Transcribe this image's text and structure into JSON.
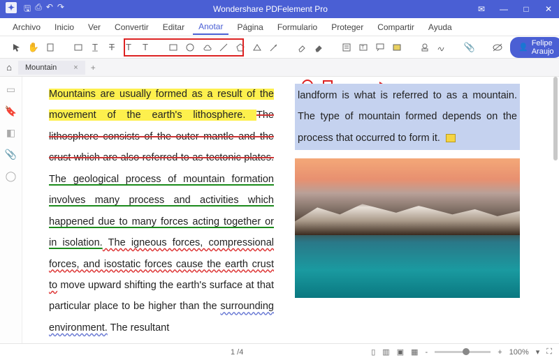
{
  "titlebar": {
    "app": "Wondershare PDFelement Pro"
  },
  "menu": {
    "items": [
      "Archivo",
      "Inicio",
      "Ver",
      "Convertir",
      "Editar",
      "Anotar",
      "Página",
      "Formulario",
      "Proteger",
      "Compartir",
      "Ayuda"
    ],
    "activeIndex": 5
  },
  "user": {
    "name": "Felipe Araujo"
  },
  "tab": {
    "name": "Mountain"
  },
  "document": {
    "col1": {
      "s1": "Mountains are usually formed as a result of the movement of the earth's lithosphere. ",
      "s2": "The lithosphere consists of the outer mantle and the crust which are also referred to as tectonic plates.",
      "s3": " The geological process of mountain formation involves many process and activities which happened due to many forces acting together or in isolation.",
      "s4": " The igneous forces, compressional forces, and isostatic forces cause the earth crust to",
      "s5": " move upward shifting the earth's surface at that particular place to be higher than the ",
      "s6": "surrounding environment.",
      "s7": " The resultant"
    },
    "col2": {
      "box": "landform is what is referred to as a mountain. The type of mountain formed depends on the process that occurred to form it."
    }
  },
  "status": {
    "page": "1 /4",
    "zoom": "100%",
    "minus": "-",
    "plus": "+"
  }
}
